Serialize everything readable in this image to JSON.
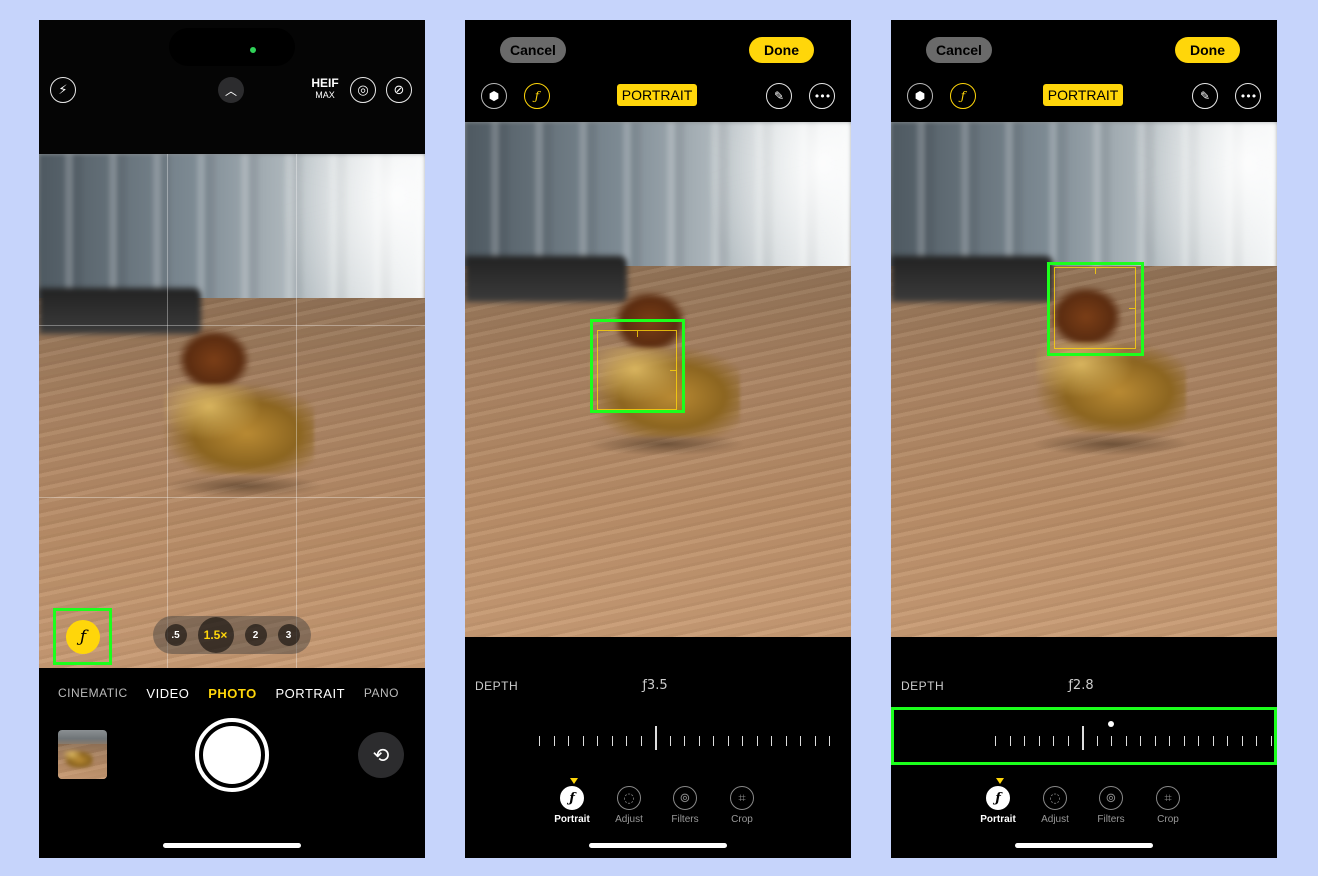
{
  "camera": {
    "heif_label": "HEIF",
    "heif_sub": "MAX",
    "aperture_symbol": "ƒ",
    "zoom_options": [
      ".5",
      "1.5×",
      "2",
      "3"
    ],
    "modes": [
      "CINEMATIC",
      "VIDEO",
      "PHOTO",
      "PORTRAIT",
      "PANO"
    ],
    "active_mode": "PHOTO",
    "icons": [
      "flash-icon",
      "chevron-up-icon",
      "live-photo-icon",
      "live-photo-off-icon",
      "flip-camera-icon"
    ]
  },
  "editor_depth_35": {
    "cancel_label": "Cancel",
    "done_label": "Done",
    "mode_badge": "PORTRAIT",
    "depth_label": "DEPTH",
    "depth_value": "ƒ3.5",
    "tabs": [
      "Portrait",
      "Adjust",
      "Filters",
      "Crop"
    ],
    "active_tab": "Portrait"
  },
  "editor_depth_28": {
    "cancel_label": "Cancel",
    "done_label": "Done",
    "mode_badge": "PORTRAIT",
    "depth_label": "DEPTH",
    "depth_value": "ƒ2.8",
    "tabs": [
      "Portrait",
      "Adjust",
      "Filters",
      "Crop"
    ],
    "active_tab": "Portrait"
  },
  "colors": {
    "accent": "#ffd60a",
    "highlight": "#1cff1c",
    "background": "#c6d4fb"
  }
}
